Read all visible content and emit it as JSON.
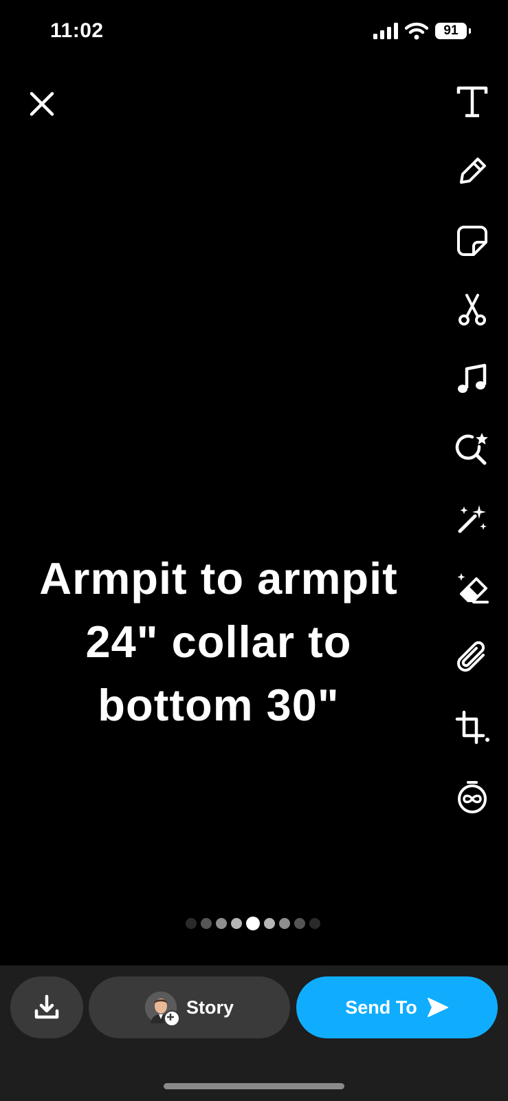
{
  "status_bar": {
    "time": "11:02",
    "battery": "91",
    "icons": [
      "cellular-signal-icon",
      "wifi-icon",
      "battery-icon"
    ]
  },
  "toolbar": {
    "close_icon": "close-icon",
    "tools": [
      "text-icon",
      "pencil-icon",
      "sticker-icon",
      "scissors-icon",
      "music-note-icon",
      "lens-search-icon",
      "magic-wand-icon",
      "eraser-icon",
      "paperclip-icon",
      "crop-icon",
      "timer-infinity-icon"
    ]
  },
  "caption": {
    "text": "Armpit to armpit\n24\" collar to\nbottom 30\""
  },
  "pager": {
    "count": 9,
    "active_index": 4
  },
  "bottom_bar": {
    "save_icon": "download-icon",
    "story_label": "Story",
    "send_label": "Send To",
    "send_color": "#10adff"
  }
}
